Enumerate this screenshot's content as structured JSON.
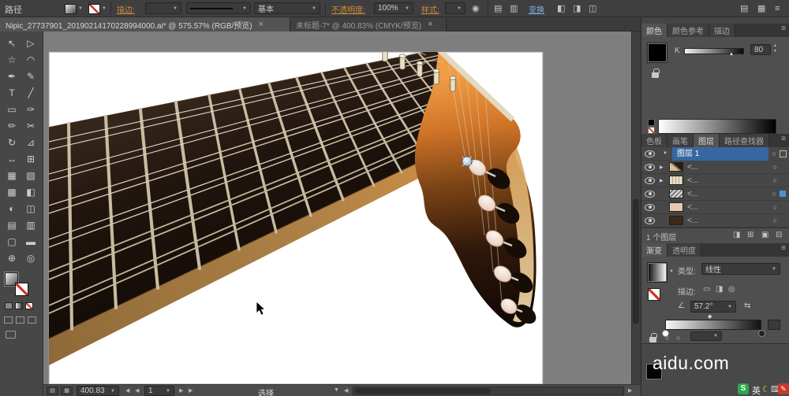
{
  "top_bar": {
    "context_label": "路径",
    "stroke_label": "描边:",
    "brush_label": "基本",
    "opacity_label": "不透明度:",
    "opacity_value": "100%",
    "style_label": "样式:",
    "transform_label": "变换"
  },
  "tabs": [
    {
      "title": "Nipic_27737901_20190214170228994000.ai* @ 575.57% (RGB/预览)"
    },
    {
      "title": "未标题-7* @ 400.83% (CMYK/预览)"
    }
  ],
  "toolbar": {
    "tools": [
      {
        "name": "selection-tool",
        "glyph": "↖"
      },
      {
        "name": "direct-selection-tool",
        "glyph": "▷"
      },
      {
        "name": "magic-wand-tool",
        "glyph": "☆"
      },
      {
        "name": "lasso-tool",
        "glyph": "◠"
      },
      {
        "name": "pen-tool",
        "glyph": "✒"
      },
      {
        "name": "curvature-tool",
        "glyph": "✎"
      },
      {
        "name": "type-tool",
        "glyph": "T"
      },
      {
        "name": "line-tool",
        "glyph": "╱"
      },
      {
        "name": "rectangle-tool",
        "glyph": "▭"
      },
      {
        "name": "paintbrush-tool",
        "glyph": "✑"
      },
      {
        "name": "pencil-tool",
        "glyph": "✏"
      },
      {
        "name": "scissors-tool",
        "glyph": "✂"
      },
      {
        "name": "rotate-tool",
        "glyph": "↻"
      },
      {
        "name": "scale-tool",
        "glyph": "⊿"
      },
      {
        "name": "width-tool",
        "glyph": "↔"
      },
      {
        "name": "free-transform-tool",
        "glyph": "⊞"
      },
      {
        "name": "shape-builder-tool",
        "glyph": "▦"
      },
      {
        "name": "perspective-grid-tool",
        "glyph": "▧"
      },
      {
        "name": "mesh-tool",
        "glyph": "▩"
      },
      {
        "name": "gradient-tool",
        "glyph": "◧"
      },
      {
        "name": "eyedropper-tool",
        "glyph": "◐"
      },
      {
        "name": "blend-tool",
        "glyph": "◫"
      },
      {
        "name": "symbol-sprayer-tool",
        "glyph": "▤"
      },
      {
        "name": "column-graph-tool",
        "glyph": "▥"
      },
      {
        "name": "artboard-tool",
        "glyph": "▢"
      },
      {
        "name": "slice-tool",
        "glyph": "▬"
      },
      {
        "name": "hand-tool",
        "glyph": "⊕"
      },
      {
        "name": "zoom-tool",
        "glyph": "◎"
      }
    ]
  },
  "panels": {
    "color_group_tabs": [
      "颜色",
      "颜色参考",
      "描边"
    ],
    "color": {
      "channel": "K",
      "value": "80"
    },
    "dock_tabs": [
      "色板",
      "画笔",
      "图层",
      "路径查找器"
    ],
    "layers": {
      "layer_name": "图层 1",
      "rows": [
        "<...",
        "<...",
        "<...",
        "<...",
        "<..."
      ],
      "footer": "1 个图层"
    },
    "gradient_group_tabs": [
      "渐变",
      "透明度"
    ],
    "gradient": {
      "type_label": "类型:",
      "type_value": "线性",
      "stroke_label": "描边:",
      "angle_value": "57.2°"
    }
  },
  "status_bar": {
    "zoom": "400.83",
    "artboard": "1",
    "tool_status": "选择"
  },
  "watermark": "aidu.com",
  "taskbar": {
    "ime": "S",
    "lang": "英",
    "pen": "✎"
  },
  "glyphs": {
    "close": "×",
    "menu": "≡",
    "dropdown": "▼",
    "prev": "◀",
    "next": "▶",
    "expand_open": "▼",
    "expand_closed": "▶",
    "target_circle": "○",
    "diamond": "◆",
    "recolor": "◉",
    "angle": "∠",
    "reverse": "⇆",
    "spin_up": "▲",
    "spin_down": "▼",
    "moon": "☾",
    "keyboard": "⌨",
    "icon_a": "▤",
    "icon_b": "▥",
    "icon_c": "▦",
    "icon_d": "◧",
    "icon_e": "◨",
    "icon_f": "◫",
    "icon_g": "⊞",
    "icon_h": "▣",
    "icon_i": "⊟",
    "stroke_mini_a": "▭",
    "stroke_mini_b": "◨",
    "stroke_mini_c": "◎"
  }
}
